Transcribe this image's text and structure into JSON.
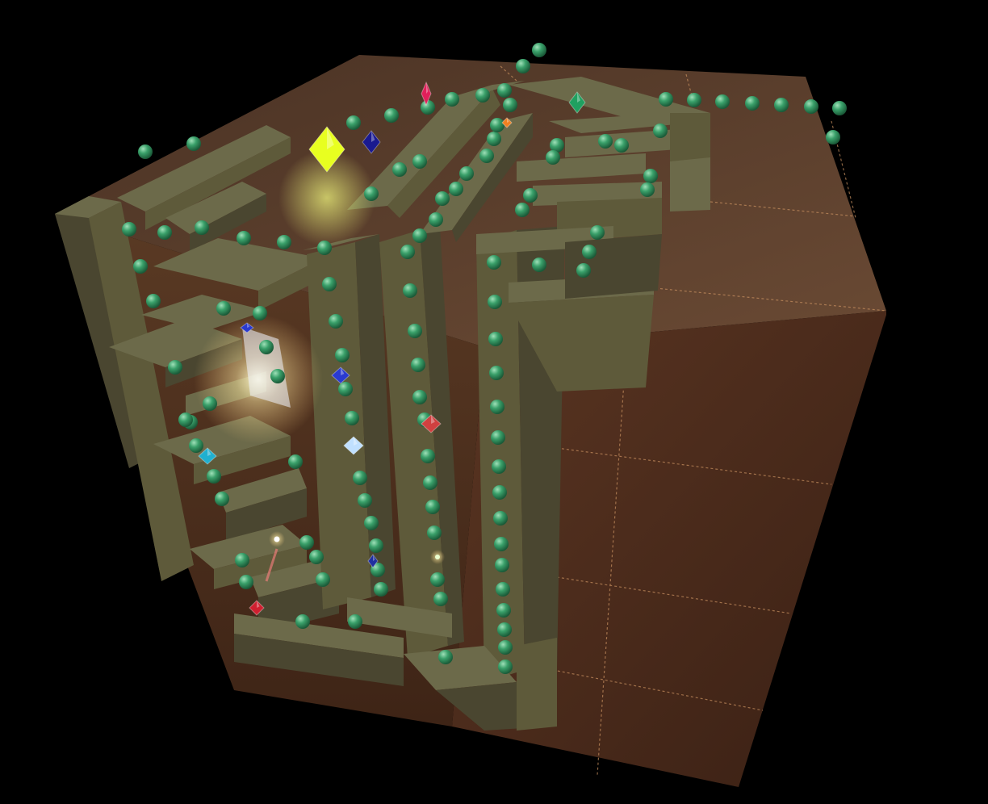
{
  "scene": {
    "kind": "3d-maze-cube",
    "background_color": "#000000",
    "cube_colors": {
      "top_face": "#5a3a28",
      "right_face": "#4a2a1c",
      "front_face": "#3e2618",
      "tile_seam": "#c89060"
    },
    "wall_colors": {
      "top": "#6c6a4a",
      "side_light": "#5e5a3a",
      "side_dark": "#4a4630"
    },
    "pellet": {
      "icon": "green-orb-icon",
      "color": "#3aa06a",
      "highlight": "#9fe0b8"
    },
    "gems": [
      {
        "icon": "crystal-cluster-icon",
        "color": "#e8ff20"
      },
      {
        "icon": "sapphire-icon",
        "color": "#1a1a90"
      },
      {
        "icon": "ruby-crystal-icon",
        "color": "#e0205a"
      },
      {
        "icon": "emerald-icon",
        "color": "#20a060"
      },
      {
        "icon": "topaz-icon",
        "color": "#f08020"
      },
      {
        "icon": "sapphire-icon",
        "color": "#2a3ad0"
      },
      {
        "icon": "sapphire-icon",
        "color": "#2a3ad0"
      },
      {
        "icon": "ruby-icon",
        "color": "#d04040"
      },
      {
        "icon": "diamond-icon",
        "color": "#c0e0ff"
      },
      {
        "icon": "aquamarine-icon",
        "color": "#20b0d0"
      },
      {
        "icon": "sapphire-icon",
        "color": "#2030a0"
      },
      {
        "icon": "ruby-icon",
        "color": "#d02030"
      }
    ],
    "player": {
      "icon": "glowing-light-orb-icon",
      "color": "#fff8d0"
    }
  }
}
